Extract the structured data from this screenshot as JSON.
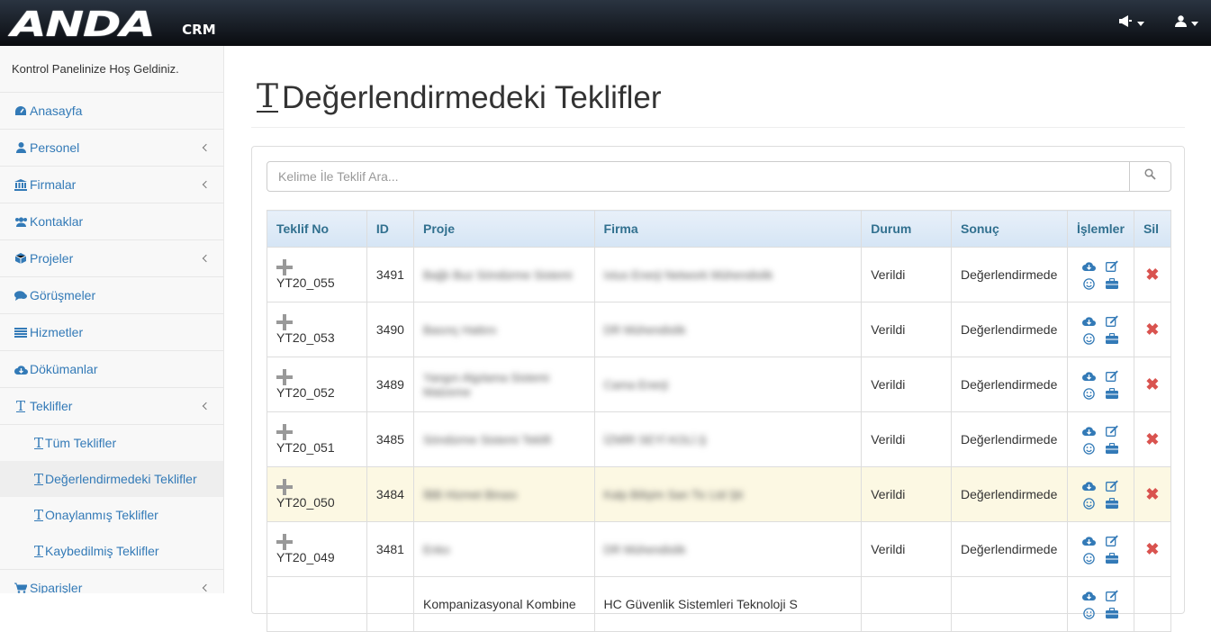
{
  "header": {
    "logo_main": "ANDA",
    "logo_sub": "CRM"
  },
  "sidebar": {
    "welcome": "Kontrol Panelinize Hoş Geldiniz.",
    "items": [
      {
        "label": "Anasayfa",
        "icon": "dashboard-icon"
      },
      {
        "label": "Personel",
        "icon": "user-icon"
      },
      {
        "label": "Firmalar",
        "icon": "bank-icon"
      },
      {
        "label": "Kontaklar",
        "icon": "users-icon"
      },
      {
        "label": "Projeler",
        "icon": "cube-icon"
      },
      {
        "label": "Görüşmeler",
        "icon": "comments-icon"
      },
      {
        "label": "Hizmetler",
        "icon": "list-icon"
      },
      {
        "label": "Dökümanlar",
        "icon": "cloud-download-icon"
      },
      {
        "label": "Teklifler",
        "icon": "text-height-icon"
      },
      {
        "label": "Siparişler",
        "icon": "shopping-cart-icon"
      }
    ],
    "subitems": [
      {
        "label": "Tüm Teklifler"
      },
      {
        "label": "Değerlendirmedeki Teklifler"
      },
      {
        "label": "Onaylanmış Teklifler"
      },
      {
        "label": "Kaybedilmiş Teklifler"
      }
    ]
  },
  "page": {
    "title": "Değerlendirmedeki Teklifler",
    "search_placeholder": "Kelime İle Teklif Ara..."
  },
  "table": {
    "headers": [
      "Teklif No",
      "ID",
      "Proje",
      "Firma",
      "Durum",
      "Sonuç",
      "İşlemler",
      "Sil"
    ],
    "rows": [
      {
        "no": "YT20_055",
        "id": "3491",
        "proje": "Bağlı Buz Söndürme Sistemi",
        "firma": "Ixtus Enerji Network Mühendislik",
        "durum": "Verildi",
        "sonuc": "Değerlendirmede"
      },
      {
        "no": "YT20_053",
        "id": "3490",
        "proje": "Basınç Hattını",
        "firma": "DR Mühendislik",
        "durum": "Verildi",
        "sonuc": "Değerlendirmede"
      },
      {
        "no": "YT20_052",
        "id": "3489",
        "proje": "Yangın Algılama Sistemi Malzeme",
        "firma": "Cama Enerji",
        "durum": "Verildi",
        "sonuc": "Değerlendirmede"
      },
      {
        "no": "YT20_051",
        "id": "3485",
        "proje": "Söndürme Sistemi Teklifi",
        "firma": "İZMİR SEYİ KOLİ.Ş",
        "durum": "Verildi",
        "sonuc": "Değerlendirmede"
      },
      {
        "no": "YT20_050",
        "id": "3484",
        "proje": "İBB Hizmet Binası",
        "firma": "Kalp Bilişim San Tic Ltd Şti",
        "durum": "Verildi",
        "sonuc": "Değerlendirmede"
      },
      {
        "no": "YT20_049",
        "id": "3481",
        "proje": "Enko",
        "firma": "DR Mühendislik",
        "durum": "Verildi",
        "sonuc": "Değerlendirmede"
      },
      {
        "no": "",
        "id": "",
        "proje": "Kompanizasyonal Kombine",
        "firma": "HC Güvenlik Sistemleri Teknoloji S",
        "durum": "",
        "sonuc": ""
      }
    ]
  },
  "colors": {
    "link": "#337ab7",
    "header_text": "#31708f",
    "delete": "#d9534f",
    "highlight_row": "#fcf8e3"
  }
}
